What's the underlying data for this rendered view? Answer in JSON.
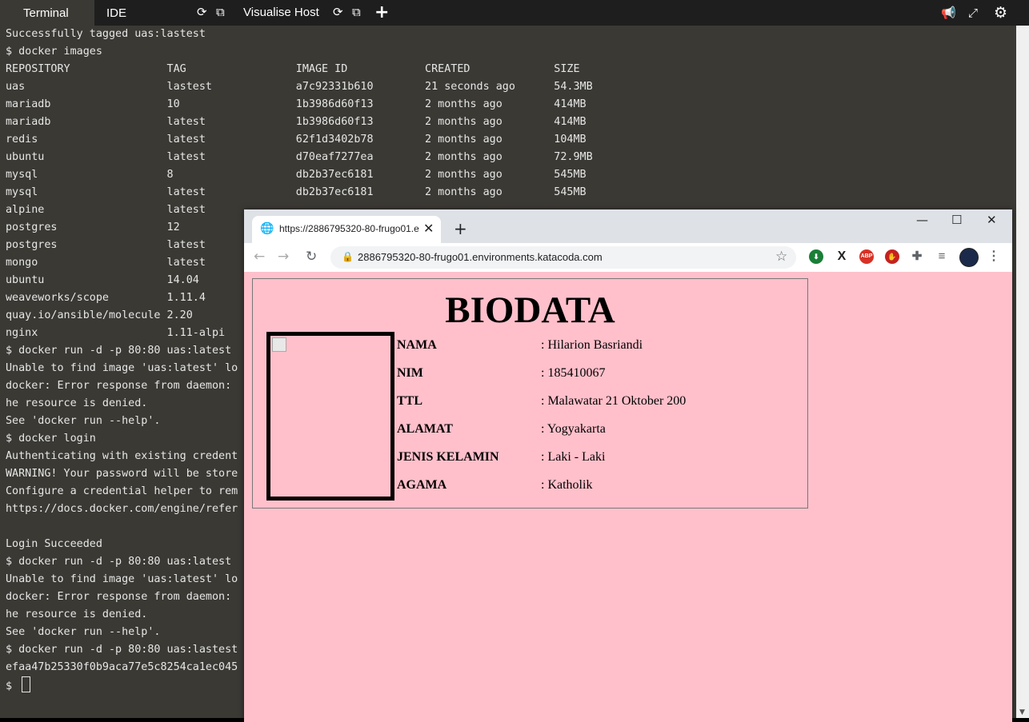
{
  "topbar": {
    "tab_terminal": "Terminal",
    "tab_ide": "IDE",
    "tab_host": "Visualise Host"
  },
  "terminal": {
    "lines": [
      "Successfully tagged uas:lastest",
      "$ docker images",
      "REPOSITORY               TAG                 IMAGE ID            CREATED             SIZE",
      "uas                      lastest             a7c92331b610        21 seconds ago      54.3MB",
      "mariadb                  10                  1b3986d60f13        2 months ago        414MB",
      "mariadb                  latest              1b3986d60f13        2 months ago        414MB",
      "redis                    latest              62f1d3402b78        2 months ago        104MB",
      "ubuntu                   latest              d70eaf7277ea        2 months ago        72.9MB",
      "mysql                    8                   db2b37ec6181        2 months ago        545MB",
      "mysql                    latest              db2b37ec6181        2 months ago        545MB",
      "alpine                   latest",
      "postgres                 12",
      "postgres                 latest",
      "mongo                    latest",
      "ubuntu                   14.04",
      "weaveworks/scope         1.11.4",
      "quay.io/ansible/molecule 2.20",
      "nginx                    1.11-alpi",
      "$ docker run -d -p 80:80 uas:latest",
      "Unable to find image 'uas:latest' lo",
      "docker: Error response from daemon:",
      "he resource is denied.",
      "See 'docker run --help'.",
      "$ docker login",
      "Authenticating with existing credent",
      "WARNING! Your password will be store",
      "Configure a credential helper to rem",
      "https://docs.docker.com/engine/refer",
      "",
      "Login Succeeded",
      "$ docker run -d -p 80:80 uas:latest",
      "Unable to find image 'uas:latest' lo",
      "docker: Error response from daemon:",
      "he resource is denied.",
      "See 'docker run --help'.",
      "$ docker run -d -p 80:80 uas:lastest",
      "efaa47b25330f0b9aca77e5c8254ca1ec045",
      "$ "
    ]
  },
  "browser": {
    "tab_title": "https://2886795320-80-frugo01.e",
    "url": "2886795320-80-frugo01.environments.katacoda.com",
    "extensions": [
      "idm-icon",
      "x-icon",
      "ABP",
      "stop-icon",
      "puzzle-icon",
      "playlist-icon",
      "profile-avatar",
      "menu-icon"
    ]
  },
  "page": {
    "heading": "BIODATA",
    "fields": [
      {
        "label": "NAMA",
        "value": ": Hilarion Basriandi"
      },
      {
        "label": "NIM",
        "value": ": 185410067"
      },
      {
        "label": "TTL",
        "value": ": Malawatar 21 Oktober 200"
      },
      {
        "label": "ALAMAT",
        "value": ": Yogyakarta"
      },
      {
        "label": "JENIS KELAMIN",
        "value": ": Laki - Laki"
      },
      {
        "label": "AGAMA",
        "value": ": Katholik"
      }
    ]
  }
}
